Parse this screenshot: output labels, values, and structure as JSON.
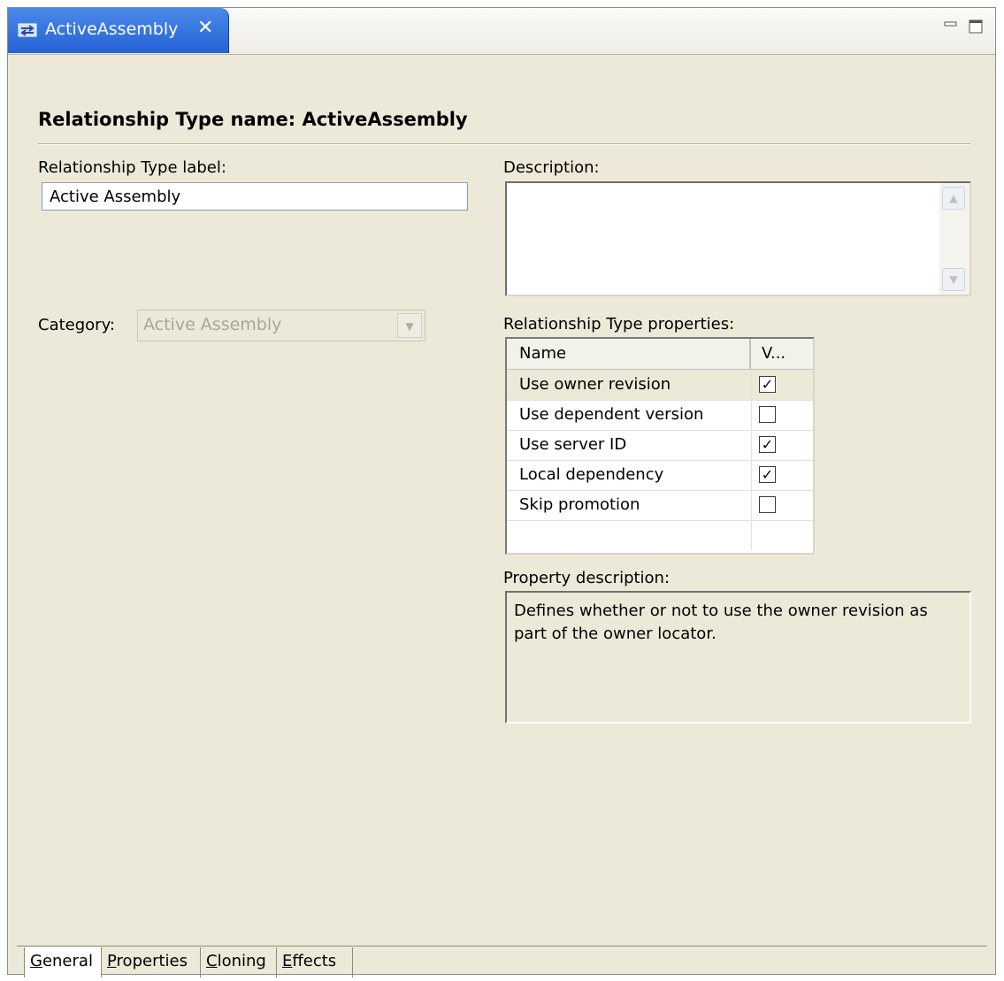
{
  "editor_tab": {
    "title": "ActiveAssembly",
    "icon": "relationship-type-icon",
    "close_glyph": "✕"
  },
  "window_controls": {
    "minimize_icon": "minimize-icon",
    "maximize_icon": "maximize-icon"
  },
  "header": {
    "title": "Relationship Type name: ActiveAssembly"
  },
  "form": {
    "label_caption": "Relationship Type label:",
    "label_value": "Active Assembly",
    "description_caption": "Description:",
    "description_value": "",
    "category_caption": "Category:",
    "category_value": "Active Assembly"
  },
  "properties": {
    "caption": "Relationship Type properties:",
    "columns": [
      "Name",
      "V..."
    ],
    "rows": [
      {
        "name": "Use owner revision",
        "checked": true,
        "check_glyph": "✓"
      },
      {
        "name": "Use dependent version",
        "checked": false,
        "check_glyph": ""
      },
      {
        "name": "Use server ID",
        "checked": true,
        "check_glyph": "✓"
      },
      {
        "name": "Local dependency",
        "checked": true,
        "check_glyph": "✓"
      },
      {
        "name": "Skip promotion",
        "checked": false,
        "check_glyph": ""
      }
    ],
    "selected_row": 0
  },
  "property_description": {
    "caption": "Property description:",
    "text": "Defines whether or not to use the owner revision as part of the owner locator."
  },
  "bottom_tabs": [
    {
      "mnemonic": "G",
      "rest": "eneral",
      "active": true
    },
    {
      "mnemonic": "P",
      "rest": "roperties",
      "active": false
    },
    {
      "mnemonic": "C",
      "rest": "loning",
      "active": false
    },
    {
      "mnemonic": "E",
      "rest": "ffects",
      "active": false
    }
  ],
  "colors": {
    "panel_bg": "#ece9d8",
    "tab_active": "#2462d6",
    "tab_text": "#ffffff"
  }
}
